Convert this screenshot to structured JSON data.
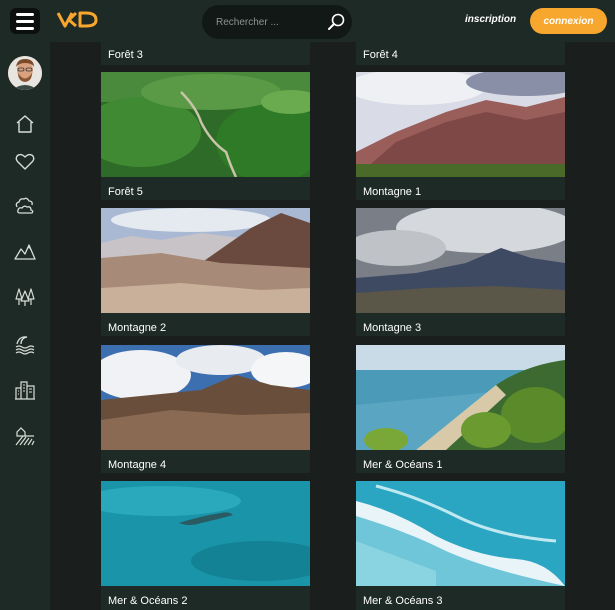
{
  "header": {
    "search_placeholder": "Rechercher ...",
    "inscription_label": "inscription",
    "connexion_label": "connexion",
    "accent_color": "#f7a72d"
  },
  "sidebar": {
    "icons": [
      "home-icon",
      "heart-icon",
      "clouds-icon",
      "mountains-icon",
      "forest-icon",
      "sea-waves-icon",
      "city-icon",
      "countryside-icon"
    ]
  },
  "gallery": {
    "top_row_labels": [
      "Forêt 3",
      "Forêt 4"
    ],
    "cards": [
      {
        "label": "Forêt 5"
      },
      {
        "label": "Montagne 1"
      },
      {
        "label": "Montagne 2"
      },
      {
        "label": "Montagne 3"
      },
      {
        "label": "Montagne 4"
      },
      {
        "label": "Mer & Océans 1"
      },
      {
        "label": "Mer & Océans 2"
      },
      {
        "label": "Mer & Océans 3"
      }
    ]
  }
}
